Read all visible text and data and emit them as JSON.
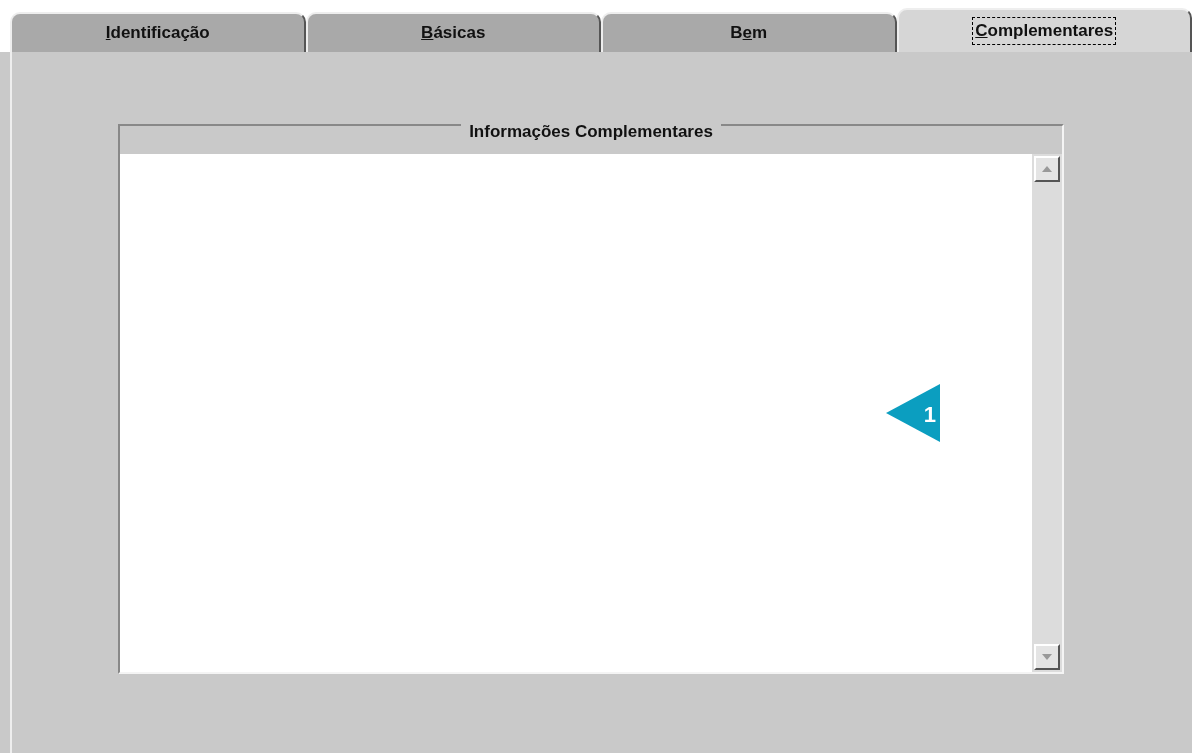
{
  "tabs": [
    {
      "accel": "I",
      "after": "dentificação",
      "selected": false
    },
    {
      "accel": "B",
      "after": "ásicas",
      "selected": false
    },
    {
      "before": "B",
      "accel": "e",
      "after": "m",
      "selected": false
    },
    {
      "accel": "C",
      "after": "omplementares",
      "selected": true
    }
  ],
  "group": {
    "title": "Informações Complementares"
  },
  "callout": {
    "number": "1"
  }
}
